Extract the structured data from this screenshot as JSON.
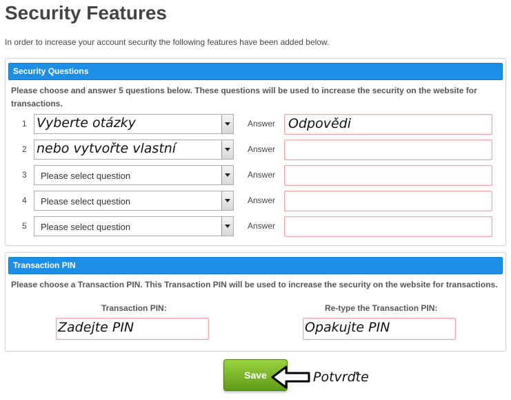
{
  "page": {
    "title": "Security Features",
    "intro": "In order to increase your account security the following features have been added below."
  },
  "security_questions": {
    "header": "Security Questions",
    "description": "Please choose and answer 5 questions below. These questions will be used to increase the security on the website for transactions.",
    "answer_label": "Answer",
    "rows": [
      {
        "num": "1",
        "question": "Vyberte otázky",
        "answer": "Odpovědi"
      },
      {
        "num": "2",
        "question": "nebo vytvořte vlastní",
        "answer": ""
      },
      {
        "num": "3",
        "question": "Please select question",
        "answer": ""
      },
      {
        "num": "4",
        "question": "Please select question",
        "answer": ""
      },
      {
        "num": "5",
        "question": "Please select question",
        "answer": ""
      }
    ]
  },
  "transaction_pin": {
    "header": "Transaction PIN",
    "description": "Please choose a Transaction PIN. This Transaction PIN will be used to increase the security on the website for transactions.",
    "pin_label": "Transaction PIN:",
    "retype_label": "Re-type the Transaction PIN:",
    "pin_value": "Zadejte PIN",
    "retype_value": "Opakujte PIN"
  },
  "actions": {
    "save_label": "Save",
    "confirm_note": "Potvrďte"
  },
  "icons": {
    "dropdown": "chevron-down-icon",
    "annotation_arrow": "arrow-left-icon"
  },
  "colors": {
    "header_blue": "#1d8ee6",
    "save_green": "#6fae22",
    "input_border": "#e9a5a5"
  }
}
